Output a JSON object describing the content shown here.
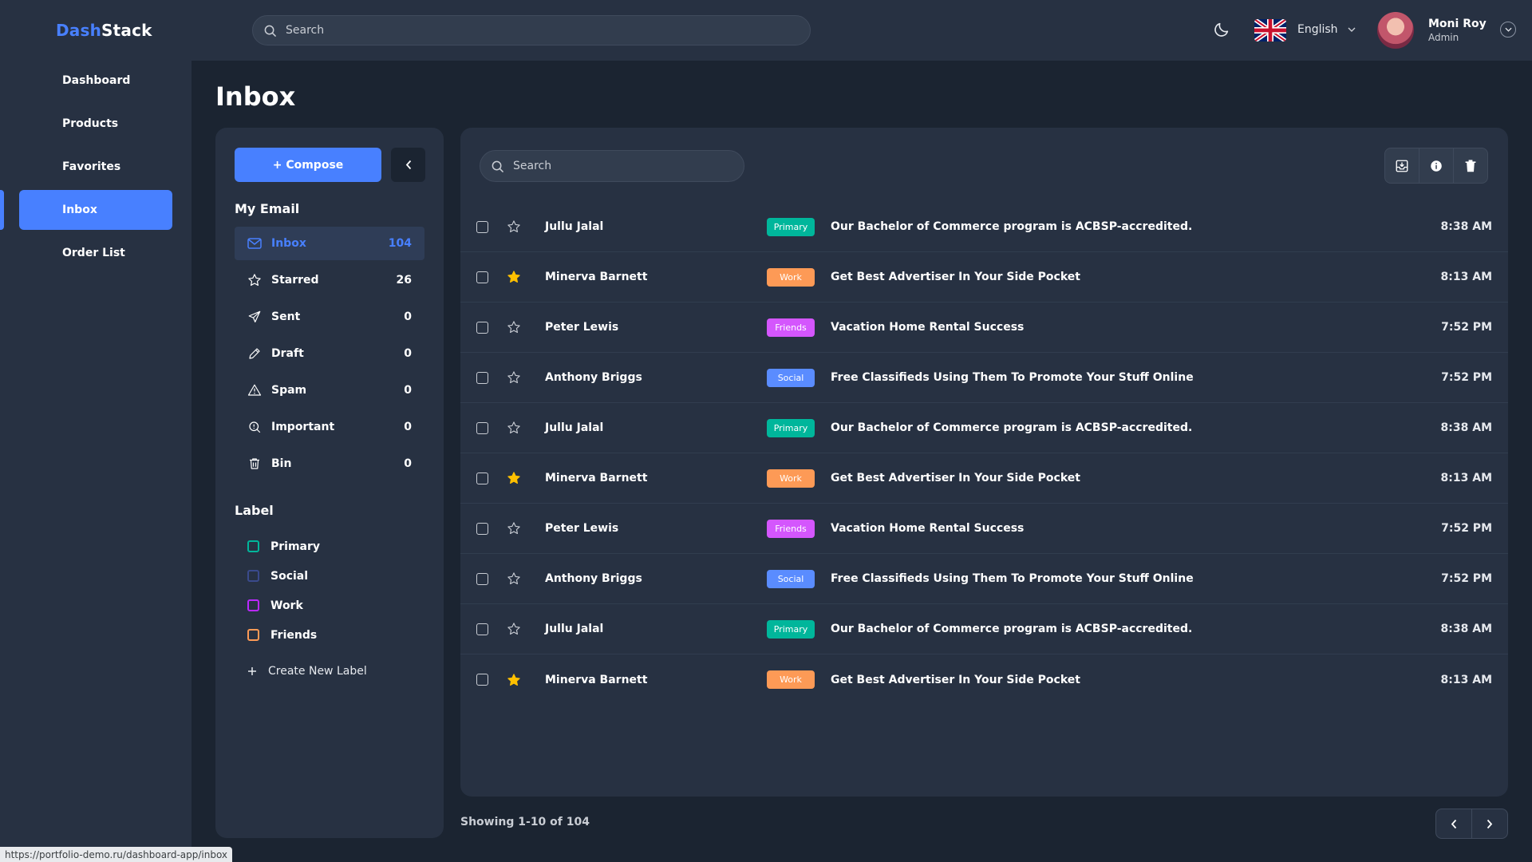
{
  "brand": {
    "part1": "Dash",
    "part2": "Stack"
  },
  "sidebar": {
    "items": [
      {
        "label": "Dashboard",
        "active": false
      },
      {
        "label": "Products",
        "active": false
      },
      {
        "label": "Favorites",
        "active": false
      },
      {
        "label": "Inbox",
        "active": true
      },
      {
        "label": "Order List",
        "active": false
      }
    ]
  },
  "header": {
    "search_placeholder": "Search",
    "language": "English",
    "user": {
      "name": "Moni Roy",
      "role": "Admin"
    }
  },
  "page": {
    "title": "Inbox"
  },
  "mail_panel": {
    "compose_label": "+ Compose",
    "my_email_title": "My Email",
    "folders": [
      {
        "name": "Inbox",
        "count": "104",
        "icon": "mail-icon",
        "active": true
      },
      {
        "name": "Starred",
        "count": "26",
        "icon": "star-icon",
        "active": false
      },
      {
        "name": "Sent",
        "count": "0",
        "icon": "send-icon",
        "active": false
      },
      {
        "name": "Draft",
        "count": "0",
        "icon": "pencil-icon",
        "active": false
      },
      {
        "name": "Spam",
        "count": "0",
        "icon": "warning-icon",
        "active": false
      },
      {
        "name": "Important",
        "count": "0",
        "icon": "important-icon",
        "active": false
      },
      {
        "name": "Bin",
        "count": "0",
        "icon": "trash-icon",
        "active": false
      }
    ],
    "label_title": "Label",
    "labels": [
      {
        "name": "Primary",
        "color": "#00b69b"
      },
      {
        "name": "Social",
        "color": "#3a4a8c"
      },
      {
        "name": "Work",
        "color": "#ba29ff"
      },
      {
        "name": "Friends",
        "color": "#fd9a56"
      }
    ],
    "create_label": "Create New Label"
  },
  "mail_list": {
    "search_placeholder": "Search",
    "colors": {
      "Primary": "#00b69b",
      "Work": "#fd9a56",
      "Friends": "#d456fd",
      "Social": "#5a8cff",
      "star": "#ffc000"
    },
    "rows": [
      {
        "sender": "Jullu Jalal",
        "starred": false,
        "tag": "Primary",
        "subject": "Our Bachelor of Commerce program is ACBSP-accredited.",
        "time": "8:38 AM"
      },
      {
        "sender": "Minerva Barnett",
        "starred": true,
        "tag": "Work",
        "subject": "Get Best Advertiser In Your Side Pocket",
        "time": "8:13 AM"
      },
      {
        "sender": "Peter Lewis",
        "starred": false,
        "tag": "Friends",
        "subject": "Vacation Home Rental Success",
        "time": "7:52 PM"
      },
      {
        "sender": "Anthony Briggs",
        "starred": false,
        "tag": "Social",
        "subject": "Free Classifieds Using Them To Promote Your Stuff Online",
        "time": "7:52 PM"
      },
      {
        "sender": "Jullu Jalal",
        "starred": false,
        "tag": "Primary",
        "subject": "Our Bachelor of Commerce program is ACBSP-accredited.",
        "time": "8:38 AM"
      },
      {
        "sender": "Minerva Barnett",
        "starred": true,
        "tag": "Work",
        "subject": "Get Best Advertiser In Your Side Pocket",
        "time": "8:13 AM"
      },
      {
        "sender": "Peter Lewis",
        "starred": false,
        "tag": "Friends",
        "subject": "Vacation Home Rental Success",
        "time": "7:52 PM"
      },
      {
        "sender": "Anthony Briggs",
        "starred": false,
        "tag": "Social",
        "subject": "Free Classifieds Using Them To Promote Your Stuff Online",
        "time": "7:52 PM"
      },
      {
        "sender": "Jullu Jalal",
        "starred": false,
        "tag": "Primary",
        "subject": "Our Bachelor of Commerce program is ACBSP-accredited.",
        "time": "8:38 AM"
      },
      {
        "sender": "Minerva Barnett",
        "starred": true,
        "tag": "Work",
        "subject": "Get Best Advertiser In Your Side Pocket",
        "time": "8:13 AM"
      }
    ]
  },
  "pagination": {
    "showing": "Showing 1-10 of 104"
  },
  "status_bar": {
    "url": "https://portfolio-demo.ru/dashboard-app/inbox"
  }
}
